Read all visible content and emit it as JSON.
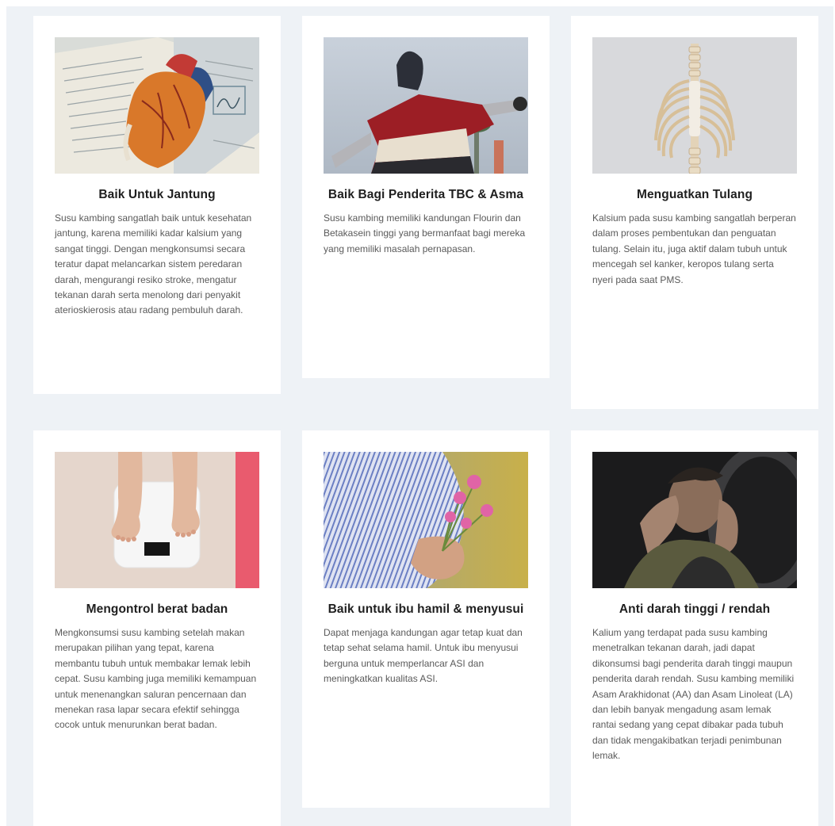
{
  "cards": [
    {
      "title": "Baik Untuk Jantung",
      "text": "Susu kambing sangatlah baik untuk kesehatan jantung, karena memiliki kadar kalsium yang sangat tinggi. Dengan mengkonsumsi secara teratur dapat melancarkan sistem peredaran darah, mengurangi resiko stroke, mengatur tekanan darah serta menolong dari penyakit aterioskierosis atau radang pembuluh darah.",
      "image": "anatomical-heart-model-on-book"
    },
    {
      "title": "Baik Bagi Penderita TBC & Asma",
      "text": "Susu kambing memiliki kandungan Flourin dan Betakasein tinggi yang bermanfaat bagi mereka yang memiliki masalah pernapasan.",
      "image": "woman-breathing-outdoors"
    },
    {
      "title": "Menguatkan Tulang",
      "text": "Kalsium pada susu kambing sangatlah berperan dalam proses pembentukan dan penguatan tulang. Selain itu, juga aktif dalam tubuh untuk mencegah sel kanker, keropos tulang serta nyeri pada saat PMS.",
      "image": "rib-cage-skeleton"
    },
    {
      "title": "Mengontrol berat badan",
      "text": "Mengkonsumsi susu kambing setelah makan merupakan pilihan yang tepat, karena membantu tubuh untuk membakar lemak lebih cepat. Susu kambing juga memiliki kemampuan untuk menenangkan saluran pencernaan dan menekan rasa lapar secara efektif sehingga cocok untuk menurunkan berat badan.",
      "image": "feet-on-bathroom-scale"
    },
    {
      "title": "Baik untuk ibu hamil & menyusui",
      "text": "Dapat menjaga kandungan agar tetap kuat dan tetap sehat selama hamil. Untuk ibu menyusui berguna untuk memperlancar ASI dan meningkatkan kualitas ASI.",
      "image": "pregnant-woman-with-flowers"
    },
    {
      "title": "Anti darah tinggi / rendah",
      "text": "Kalium yang terdapat pada susu kambing menetralkan tekanan darah, jadi dapat dikonsumsi bagi penderita darah tinggi maupun penderita darah rendah. Susu kambing memiliki Asam Arakhidonat (AA) dan Asam Linoleat (LA) dan lebih banyak mengadung asam lemak rantai sedang yang cepat dibakar pada tubuh dan tidak mengakibatkan terjadi penimbunan lemak.",
      "image": "man-with-headache"
    }
  ]
}
